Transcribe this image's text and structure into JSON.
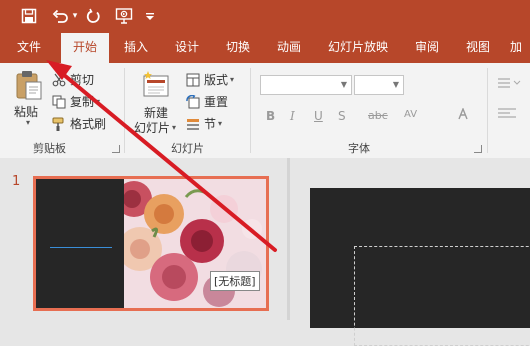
{
  "quick_access": {
    "icons": [
      "save-icon",
      "undo-icon",
      "redo-icon",
      "present-icon",
      "customize-icon"
    ],
    "undo_caret": "▾"
  },
  "tabs": [
    {
      "label": "文件",
      "active": false
    },
    {
      "label": "开始",
      "active": true
    },
    {
      "label": "插入",
      "active": false
    },
    {
      "label": "设计",
      "active": false
    },
    {
      "label": "切换",
      "active": false
    },
    {
      "label": "动画",
      "active": false
    },
    {
      "label": "幻灯片放映",
      "active": false
    },
    {
      "label": "审阅",
      "active": false
    },
    {
      "label": "视图",
      "active": false
    },
    {
      "label": "加",
      "active": false
    }
  ],
  "ribbon": {
    "clipboard": {
      "paste": "粘贴",
      "cut": "剪切",
      "copy": "复制",
      "format_painter": "格式刷",
      "group": "剪贴板"
    },
    "slides": {
      "new_slide_line1": "新建",
      "new_slide_line2": "幻灯片",
      "layout": "版式",
      "reset": "重置",
      "section": "节",
      "group": "幻灯片"
    },
    "font": {
      "group": "字体",
      "format_buttons": [
        "B",
        "I",
        "U",
        "S",
        "abc",
        "AV"
      ]
    }
  },
  "slide_panel": {
    "slide_number": "1",
    "title_placeholder": "[无标题]"
  },
  "colors": {
    "accent": "#b7472a",
    "selection": "#e76e52",
    "annotation_arrow": "#d81c24"
  }
}
